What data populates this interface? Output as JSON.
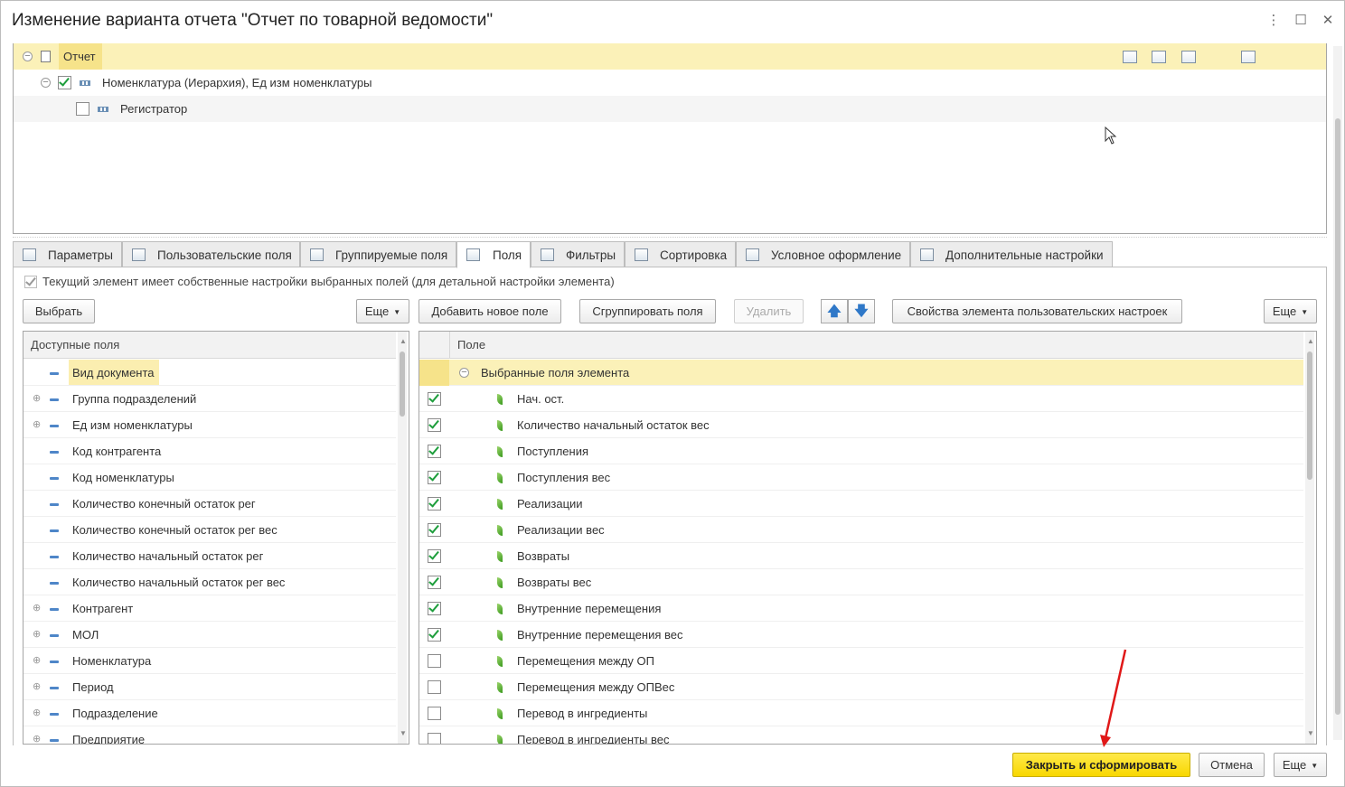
{
  "window": {
    "title": "Изменение варианта отчета \"Отчет по товарной ведомости\""
  },
  "structure": {
    "rows": [
      {
        "label": "Отчет"
      },
      {
        "label": "Номенклатура (Иерархия), Ед изм номенклатуры"
      },
      {
        "label": "Регистратор"
      }
    ]
  },
  "tabs": [
    {
      "label": "Параметры"
    },
    {
      "label": "Пользовательские поля"
    },
    {
      "label": "Группируемые поля"
    },
    {
      "label": "Поля"
    },
    {
      "label": "Фильтры"
    },
    {
      "label": "Сортировка"
    },
    {
      "label": "Условное оформление"
    },
    {
      "label": "Дополнительные настройки"
    }
  ],
  "fields_tab": {
    "own_settings_label": "Текущий элемент имеет собственные настройки выбранных полей (для детальной настройки элемента)",
    "select_button": "Выбрать",
    "more_left": "Еще",
    "add_field": "Добавить новое поле",
    "group_fields": "Сгруппировать поля",
    "delete": "Удалить",
    "element_props": "Свойства элемента пользовательских настроек",
    "more_right": "Еще"
  },
  "available": {
    "header": "Доступные поля",
    "items": [
      {
        "label": "Вид документа",
        "expand": false
      },
      {
        "label": "Группа подразделений",
        "expand": true
      },
      {
        "label": "Ед изм номенклатуры",
        "expand": true
      },
      {
        "label": "Код контрагента",
        "expand": false
      },
      {
        "label": "Код номенклатуры",
        "expand": false
      },
      {
        "label": "Количество конечный остаток рег",
        "expand": false
      },
      {
        "label": "Количество конечный остаток рег вес",
        "expand": false
      },
      {
        "label": "Количество начальный остаток рег",
        "expand": false
      },
      {
        "label": "Количество начальный остаток рег вес",
        "expand": false
      },
      {
        "label": "Контрагент",
        "expand": true
      },
      {
        "label": "МОЛ",
        "expand": true
      },
      {
        "label": "Номенклатура",
        "expand": true
      },
      {
        "label": "Период",
        "expand": true
      },
      {
        "label": "Подразделение",
        "expand": true
      },
      {
        "label": "Предприятие",
        "expand": true
      }
    ]
  },
  "selected": {
    "header": "Поле",
    "group": "Выбранные поля элемента",
    "items": [
      {
        "label": "Нач. ост.",
        "checked": true
      },
      {
        "label": "Количество начальный остаток вес",
        "checked": true
      },
      {
        "label": "Поступления",
        "checked": true
      },
      {
        "label": "Поступления вес",
        "checked": true
      },
      {
        "label": "Реализации",
        "checked": true
      },
      {
        "label": "Реализации вес",
        "checked": true
      },
      {
        "label": "Возвраты",
        "checked": true
      },
      {
        "label": "Возвраты вес",
        "checked": true
      },
      {
        "label": "Внутренние перемещения",
        "checked": true
      },
      {
        "label": "Внутренние перемещения вес",
        "checked": true
      },
      {
        "label": "Перемещения между ОП",
        "checked": false
      },
      {
        "label": "Перемещения между ОПВес",
        "checked": false
      },
      {
        "label": "Перевод в ингредиенты",
        "checked": false
      },
      {
        "label": "Перевод в ингредиенты вес",
        "checked": false
      }
    ]
  },
  "footer": {
    "close_generate": "Закрыть и сформировать",
    "cancel": "Отмена",
    "more": "Еще"
  },
  "colors": {
    "accent_yellow": "#f8d700",
    "selection": "#fbf1b8",
    "check_green": "#1e9e3c"
  }
}
